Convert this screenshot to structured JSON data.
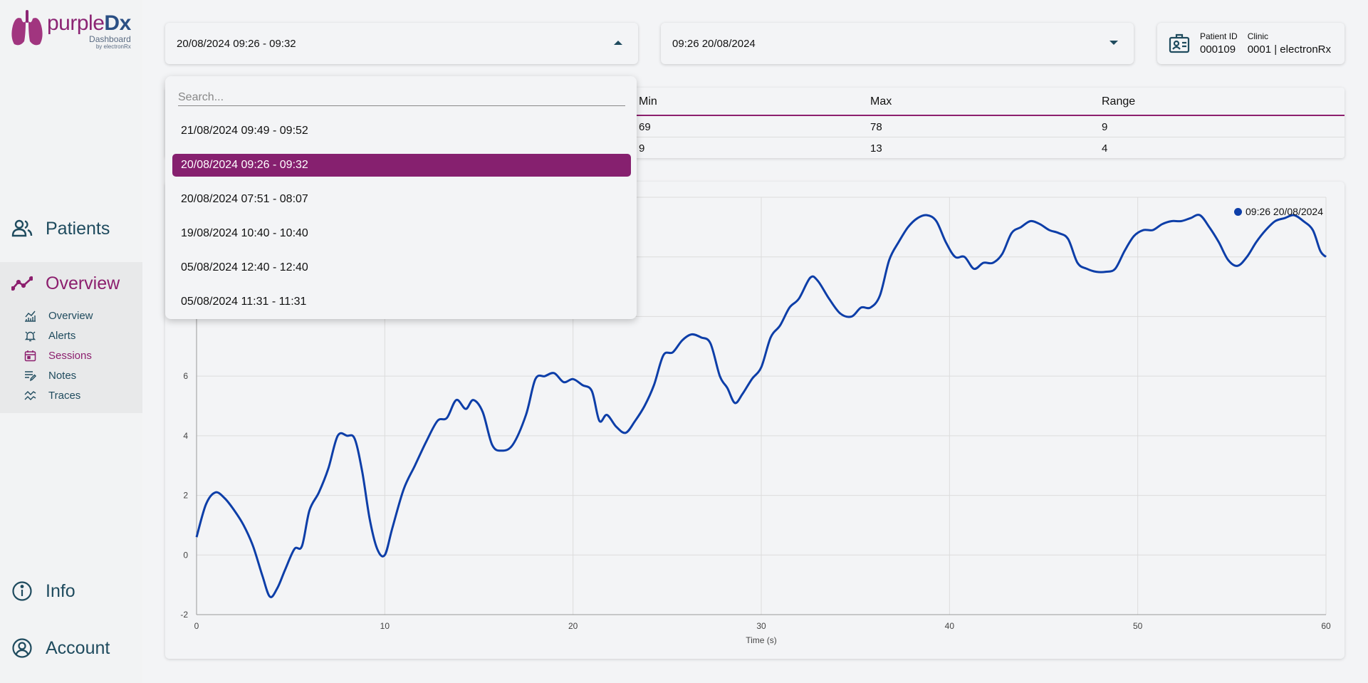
{
  "logo": {
    "brand_purple": "purple",
    "brand_dx": "Dx",
    "sub": "Dashboard",
    "by": "by electronRx"
  },
  "nav": {
    "patients": "Patients",
    "overview": "Overview",
    "sub": [
      "Overview",
      "Alerts",
      "Sessions",
      "Notes",
      "Traces"
    ],
    "info": "Info",
    "account": "Account"
  },
  "session_select": {
    "value": "20/08/2024 09:26 - 09:32"
  },
  "trace_select": {
    "value": "09:26 20/08/2024"
  },
  "patient": {
    "id_label": "Patient ID",
    "id_value": "000109",
    "clinic_label": "Clinic",
    "clinic_value": "0001 | electronRx"
  },
  "stats": {
    "headers": [
      "Min",
      "Max",
      "Range"
    ],
    "rows": [
      [
        "69",
        "78",
        "9"
      ],
      [
        "9",
        "13",
        "4"
      ]
    ]
  },
  "dropdown": {
    "placeholder": "Search...",
    "items": [
      "21/08/2024 09:49 - 09:52",
      "20/08/2024 09:26 - 09:32",
      "20/08/2024 07:51 - 08:07",
      "19/08/2024 10:40 - 10:40",
      "05/08/2024 12:40 - 12:40",
      "05/08/2024 11:31 - 11:31"
    ],
    "selected_index": 1
  },
  "colors": {
    "accent": "#8c1f6e",
    "nav": "#1f4b5e",
    "series": "#0d3ea8"
  },
  "chart_data": {
    "type": "line",
    "xlabel": "Time (s)",
    "ylabel": "",
    "xlim": [
      0,
      60
    ],
    "ylim": [
      -2,
      12
    ],
    "x_ticks": [
      0,
      10,
      20,
      30,
      40,
      50,
      60
    ],
    "y_ticks": [
      -2,
      0,
      2,
      4,
      6
    ],
    "grid": true,
    "legend_position": "top-right",
    "series": [
      {
        "name": "09:26 20/08/2024",
        "points": [
          [
            0,
            0.6
          ],
          [
            0.5,
            1.7
          ],
          [
            1,
            2.1
          ],
          [
            1.5,
            1.9
          ],
          [
            2,
            1.5
          ],
          [
            2.5,
            1.0
          ],
          [
            3,
            0.3
          ],
          [
            3.5,
            -0.7
          ],
          [
            3.9,
            -1.4
          ],
          [
            4.3,
            -1.1
          ],
          [
            4.7,
            -0.5
          ],
          [
            5.2,
            0.2
          ],
          [
            5.6,
            0.3
          ],
          [
            6,
            1.5
          ],
          [
            6.5,
            2.1
          ],
          [
            7,
            2.9
          ],
          [
            7.5,
            4.0
          ],
          [
            8,
            4.0
          ],
          [
            8.4,
            3.9
          ],
          [
            8.8,
            2.8
          ],
          [
            9.2,
            1.2
          ],
          [
            9.6,
            0.2
          ],
          [
            10,
            0.0
          ],
          [
            10.4,
            0.9
          ],
          [
            11,
            2.2
          ],
          [
            11.6,
            3.0
          ],
          [
            12.2,
            3.8
          ],
          [
            12.8,
            4.5
          ],
          [
            13.3,
            4.6
          ],
          [
            13.8,
            5.2
          ],
          [
            14.3,
            4.9
          ],
          [
            14.7,
            5.2
          ],
          [
            15.2,
            4.8
          ],
          [
            15.7,
            3.7
          ],
          [
            16.2,
            3.5
          ],
          [
            16.8,
            3.7
          ],
          [
            17.5,
            4.7
          ],
          [
            18,
            5.9
          ],
          [
            18.5,
            6.0
          ],
          [
            19,
            6.1
          ],
          [
            19.5,
            5.8
          ],
          [
            20,
            5.9
          ],
          [
            20.5,
            5.7
          ],
          [
            21,
            5.5
          ],
          [
            21.4,
            4.5
          ],
          [
            21.8,
            4.7
          ],
          [
            22.3,
            4.3
          ],
          [
            22.8,
            4.1
          ],
          [
            23.3,
            4.5
          ],
          [
            23.8,
            5.0
          ],
          [
            24.3,
            5.7
          ],
          [
            24.8,
            6.7
          ],
          [
            25.3,
            6.8
          ],
          [
            25.8,
            7.2
          ],
          [
            26.3,
            7.4
          ],
          [
            26.8,
            7.3
          ],
          [
            27.3,
            7.1
          ],
          [
            27.8,
            6.0
          ],
          [
            28.2,
            5.6
          ],
          [
            28.6,
            5.1
          ],
          [
            29,
            5.4
          ],
          [
            29.5,
            5.9
          ],
          [
            30,
            6.3
          ],
          [
            30.5,
            7.3
          ],
          [
            31,
            7.7
          ],
          [
            31.5,
            8.3
          ],
          [
            32,
            8.6
          ],
          [
            32.6,
            9.3
          ],
          [
            33,
            9.2
          ],
          [
            33.6,
            8.6
          ],
          [
            34.2,
            8.1
          ],
          [
            34.8,
            8.0
          ],
          [
            35.3,
            8.3
          ],
          [
            35.8,
            8.3
          ],
          [
            36.3,
            8.7
          ],
          [
            36.8,
            9.9
          ],
          [
            37.3,
            10.5
          ],
          [
            37.8,
            11.0
          ],
          [
            38.3,
            11.3
          ],
          [
            38.8,
            11.4
          ],
          [
            39.3,
            11.2
          ],
          [
            39.8,
            10.5
          ],
          [
            40.3,
            10.0
          ],
          [
            40.8,
            10.0
          ],
          [
            41.3,
            9.6
          ],
          [
            41.8,
            9.8
          ],
          [
            42.3,
            9.8
          ],
          [
            42.8,
            10.1
          ],
          [
            43.3,
            10.8
          ],
          [
            43.8,
            11.0
          ],
          [
            44.3,
            11.2
          ],
          [
            44.8,
            11.1
          ],
          [
            45.3,
            10.9
          ],
          [
            45.8,
            10.8
          ],
          [
            46.3,
            10.6
          ],
          [
            46.8,
            9.8
          ],
          [
            47.3,
            9.6
          ],
          [
            47.8,
            9.5
          ],
          [
            48.3,
            9.5
          ],
          [
            48.8,
            9.6
          ],
          [
            49.3,
            10.2
          ],
          [
            49.8,
            10.7
          ],
          [
            50.3,
            10.9
          ],
          [
            50.8,
            10.9
          ],
          [
            51.3,
            11.1
          ],
          [
            51.8,
            11.2
          ],
          [
            52.3,
            11.2
          ],
          [
            52.8,
            11.3
          ],
          [
            53.3,
            11.4
          ],
          [
            53.8,
            11.0
          ],
          [
            54.3,
            10.5
          ],
          [
            54.8,
            9.9
          ],
          [
            55.3,
            9.7
          ],
          [
            55.8,
            10.0
          ],
          [
            56.3,
            10.5
          ],
          [
            56.8,
            10.9
          ],
          [
            57.3,
            11.2
          ],
          [
            57.8,
            11.3
          ],
          [
            58.3,
            11.4
          ],
          [
            58.8,
            11.2
          ],
          [
            59.3,
            10.9
          ],
          [
            59.7,
            10.2
          ],
          [
            60,
            10.0
          ]
        ]
      }
    ]
  }
}
